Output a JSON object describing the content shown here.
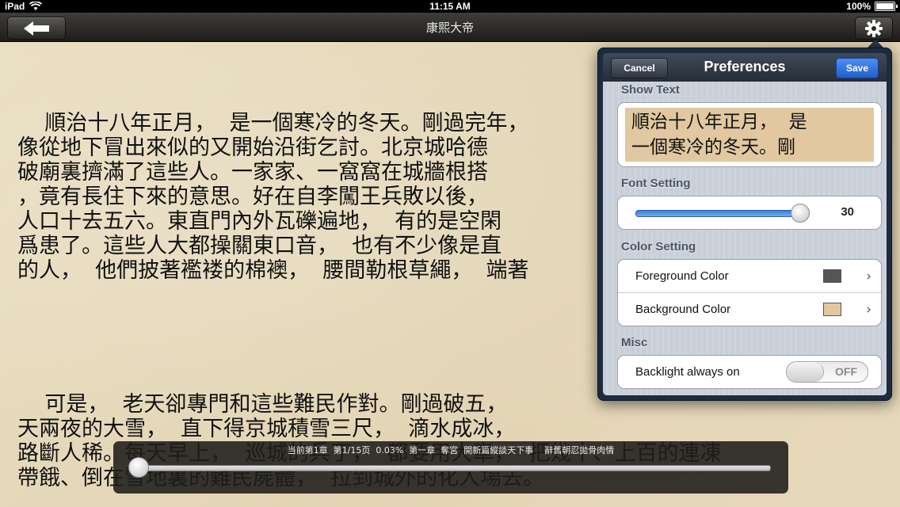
{
  "status_bar": {
    "device": "iPad",
    "time": "11:15 AM",
    "battery": "100%"
  },
  "nav": {
    "title": "康熙大帝"
  },
  "book": {
    "paragraph1": "    順治十八年正月，  是一個寒冷的冬天。剛過完年，\n像從地下冒出來似的又開始沿街乞討。北京城哈德\n破廟裏擠滿了這些人。一家家、一窩窩在城牆根搭\n，竟有長住下來的意思。好在自李闖王兵敗以後，\n人口十去五六。東直門內外瓦礫遍地，  有的是空閑\n爲患了。這些人大都操關東口音，  也有不少像是直\n的人，  他們披著襤褛的棉襖，  腰間勒根草繩，  端著",
    "paragraph2": "    可是，  老天卻專門和這些難民作對。剛過破五，\n天兩夜的大雪，  直下得京城積雪三尺，  滴水成冰，\n路斷人稀。每天早上，  巡城的兵丁，  都要用大車，  把幾十、上百的連凍\n帶餓、倒在雪地裏的難民屍體，  拉到城外的化人場去。"
  },
  "preferences": {
    "title": "Preferences",
    "cancel_label": "Cancel",
    "save_label": "Save",
    "show_text": {
      "label": "Show Text",
      "preview": "順治十八年正月，  是\n一個寒冷的冬天。剛"
    },
    "font_setting": {
      "label": "Font Setting",
      "value": "30",
      "slider_fraction": 0.95
    },
    "color_setting": {
      "label": "Color Setting",
      "foreground_label": "Foreground Color",
      "foreground_color": "#555555",
      "background_label": "Background Color",
      "background_color": "#e1c8a0"
    },
    "misc": {
      "label": "Misc",
      "backlight_label": "Backlight always on",
      "backlight_state": "OFF"
    }
  },
  "progress": {
    "info": "当前第1章  第1/15页  0.03%  第一章  奪宮  開新篇縱談天下事    辭舊朝忍拋骨肉情",
    "fraction": 0.0003
  }
}
